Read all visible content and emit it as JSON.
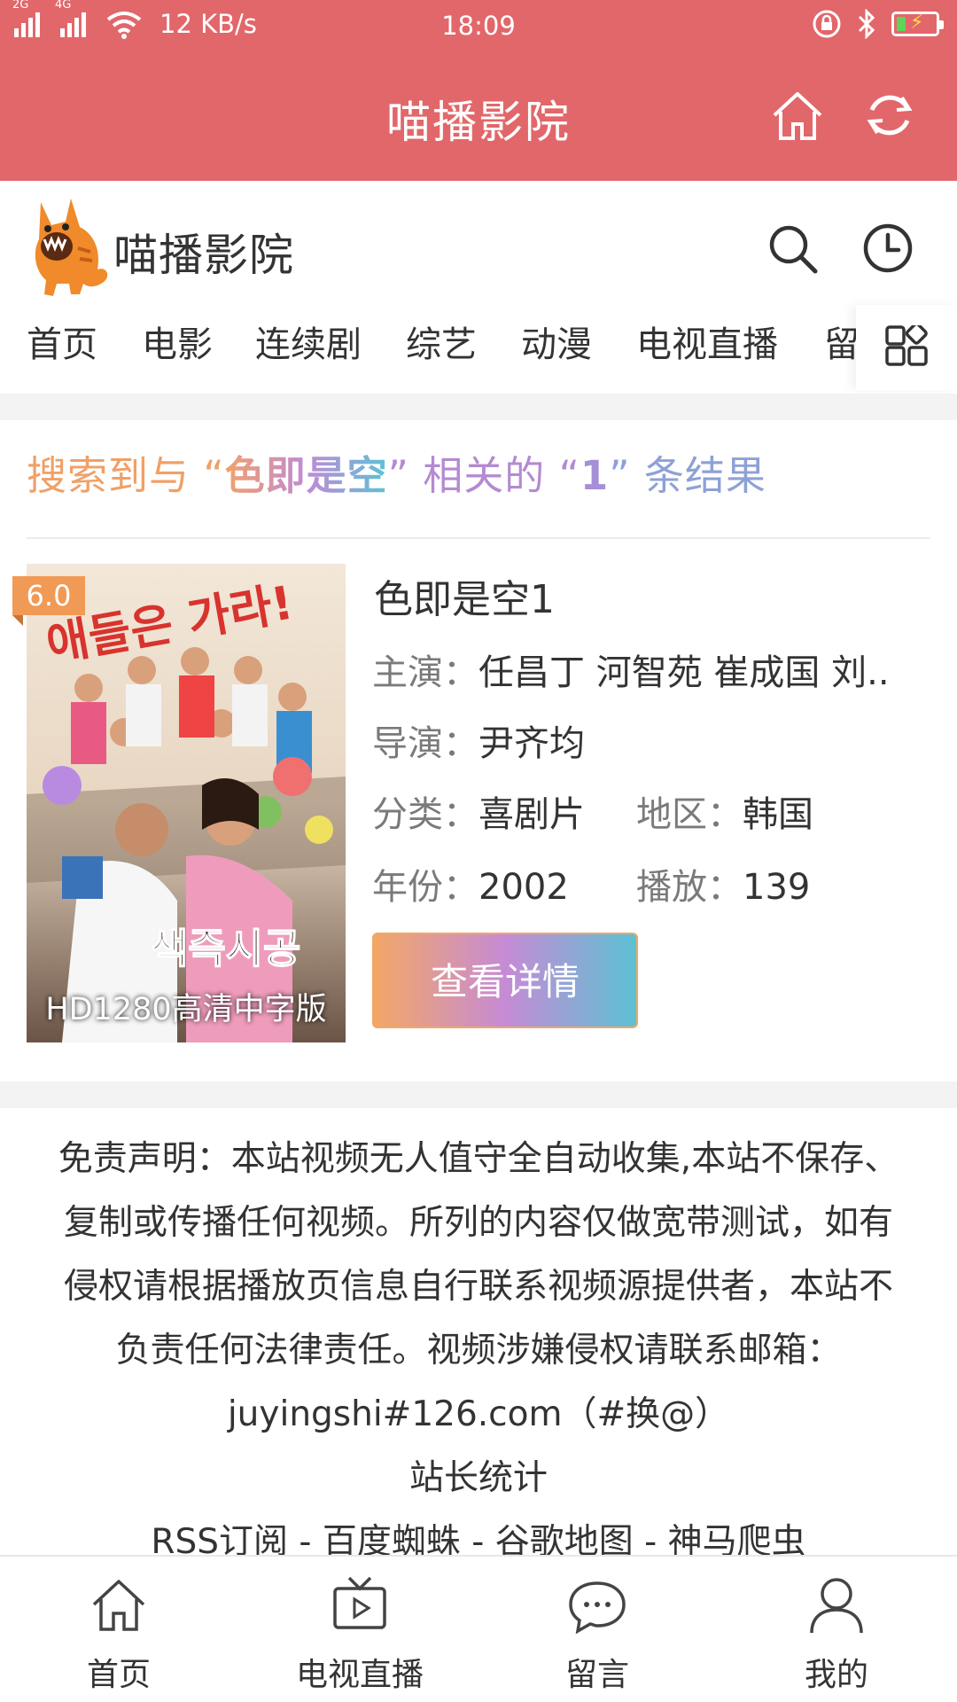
{
  "status_bar": {
    "net_labels": [
      "2G",
      "4G"
    ],
    "speed": "12 KB/s",
    "time": "18:09"
  },
  "header": {
    "title": "喵播影院",
    "home_icon": "home-icon",
    "refresh_icon": "refresh-icon"
  },
  "site": {
    "logo_text": "喵播影院",
    "search_icon": "search-icon",
    "history_icon": "history-clock-icon"
  },
  "nav": {
    "tabs": [
      "首页",
      "电影",
      "连续剧",
      "综艺",
      "动漫",
      "电视直播",
      "留"
    ],
    "more_icon": "grid-apps-icon"
  },
  "search": {
    "prefix": "搜索到与",
    "keyword": "色即是空",
    "middle": "相关的",
    "count": "1",
    "suffix": "条结果"
  },
  "movie": {
    "rating": "6.0",
    "poster_caption": "HD1280高清中字版",
    "title": "色即是空1",
    "cast_label": "主演：",
    "cast": "任昌丁 河智苑 崔成国 刘..",
    "director_label": "导演：",
    "director": "尹齐均",
    "genre_label": "分类：",
    "genre": "喜剧片",
    "region_label": "地区：",
    "region": "韩国",
    "year_label": "年份：",
    "year": "2002",
    "plays_label": "播放：",
    "plays": "139",
    "detail_button": "查看详情"
  },
  "footer": {
    "line1": "免责声明：本站视频无人值守全自动收集,本站不保存、",
    "line2": "复制或传播任何视频。所列的内容仅做宽带测试，如有",
    "line3": "侵权请根据播放页信息自行联系视频源提供者，本站不",
    "line4": "负责任何法律责任。视频涉嫌侵权请联系邮箱：",
    "line5": "juyingshi#126.com（#换@）",
    "line6": "站长统计",
    "line7": "RSS订阅 - 百度蜘蛛 - 谷歌地图 - 神马爬虫"
  },
  "bottom_nav": [
    {
      "label": "首页",
      "icon": "home-icon"
    },
    {
      "label": "电视直播",
      "icon": "tv-icon"
    },
    {
      "label": "留言",
      "icon": "chat-bubble-icon"
    },
    {
      "label": "我的",
      "icon": "user-icon"
    }
  ],
  "colors": {
    "header_bg": "#e2676a",
    "accent_orange": "#f2a766",
    "accent_purple": "#c68bd5",
    "accent_teal": "#5cc1d4"
  }
}
